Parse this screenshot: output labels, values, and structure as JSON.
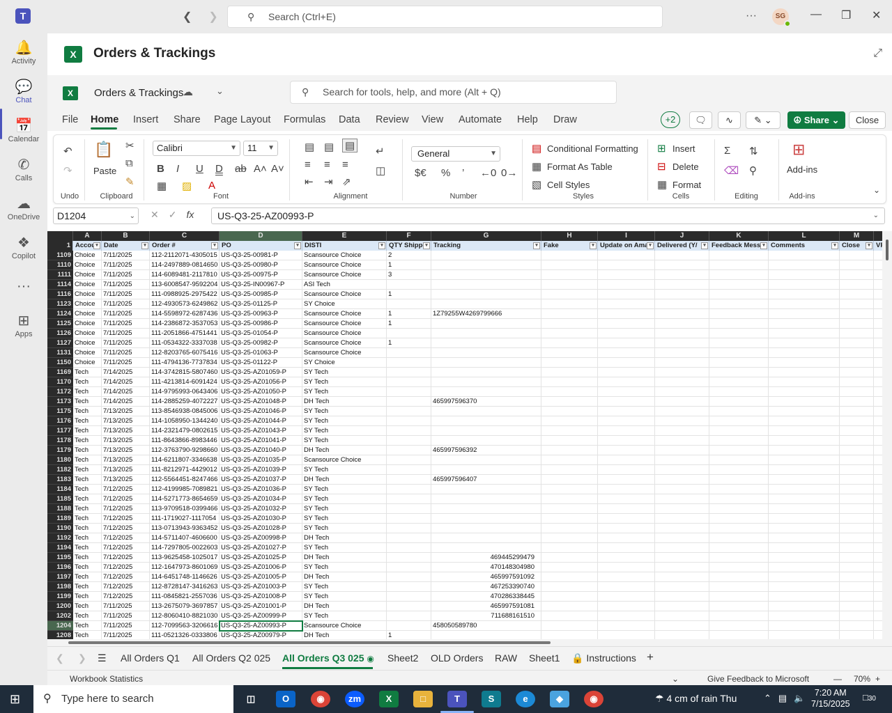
{
  "teams": {
    "search_placeholder": "Search (Ctrl+E)",
    "avatar_initials": "SG",
    "rail": [
      {
        "label": "Activity",
        "icon": "bell-icon"
      },
      {
        "label": "Chat",
        "icon": "chat-icon"
      },
      {
        "label": "Calendar",
        "icon": "calendar-icon"
      },
      {
        "label": "Calls",
        "icon": "phone-icon"
      },
      {
        "label": "OneDrive",
        "icon": "cloud-icon"
      },
      {
        "label": "Copilot",
        "icon": "copilot-icon"
      },
      {
        "label": "Apps",
        "icon": "apps-icon"
      }
    ]
  },
  "app": {
    "title": "Orders & Trackings",
    "doc_name": "Orders & Trackings",
    "tools_search": "Search for tools, help, and more (Alt + Q)",
    "menus": [
      "File",
      "Home",
      "Insert",
      "Share",
      "Page Layout",
      "Formulas",
      "Data",
      "Review",
      "View",
      "Automate",
      "Help",
      "Draw"
    ],
    "collaborators": "+2",
    "share_label": "Share",
    "close_label": "Close"
  },
  "ribbon": {
    "undo_label": "Undo",
    "clipboard_label": "Clipboard",
    "paste_label": "Paste",
    "font_label": "Font",
    "font_name": "Calibri",
    "font_size": "11",
    "alignment_label": "Alignment",
    "number_label": "Number",
    "number_format": "General",
    "styles_label": "Styles",
    "conditional_formatting": "Conditional Formatting",
    "format_as_table": "Format As Table",
    "cell_styles": "Cell Styles",
    "cells_label": "Cells",
    "insert": "Insert",
    "delete": "Delete",
    "format": "Format",
    "editing_label": "Editing",
    "addins_label": "Add-ins",
    "addins_btn": "Add-ins"
  },
  "formula_bar": {
    "name_box": "D1204",
    "formula": "US-Q3-25-AZ00993-P"
  },
  "sheet": {
    "columns": [
      "A",
      "B",
      "C",
      "D",
      "E",
      "F",
      "G",
      "H",
      "I",
      "J",
      "K",
      "L",
      "M"
    ],
    "headers": [
      "Accou",
      "Date",
      "Order #",
      "PO",
      "DISTI",
      "QTY Shippe",
      "Tracking",
      "Fake",
      "Update on Ama",
      "Delivered (Y/",
      "Feedback Messa",
      "Comments",
      "Close",
      "VP"
    ],
    "header_row_num": "1",
    "rows": [
      [
        "1109",
        "Choice",
        "7/11/2025",
        "112-2112071-4305015",
        "US-Q3-25-00981-P",
        "Scansource Choice",
        "2",
        "",
        ""
      ],
      [
        "1110",
        "Choice",
        "7/11/2025",
        "114-2497889-0814650",
        "US-Q3-25-00980-P",
        "Scansource Choice",
        "1",
        "",
        ""
      ],
      [
        "1111",
        "Choice",
        "7/11/2025",
        "114-6089481-2117810",
        "US-Q3-25-00975-P",
        "Scansource Choice",
        "3",
        "",
        ""
      ],
      [
        "1114",
        "Choice",
        "7/11/2025",
        "113-6008547-9592204",
        "US-Q3-25-IN00967-P",
        "ASI Tech",
        "",
        "",
        ""
      ],
      [
        "1116",
        "Choice",
        "7/11/2025",
        "111-0988925-2975422",
        "US-Q3-25-00985-P",
        "Scansource Choice",
        "1",
        "",
        ""
      ],
      [
        "1123",
        "Choice",
        "7/11/2025",
        "112-4930573-6249862",
        "US-Q3-25-01125-P",
        "SY Choice",
        "",
        "",
        ""
      ],
      [
        "1124",
        "Choice",
        "7/11/2025",
        "114-5598972-6287436",
        "US-Q3-25-00963-P",
        "Scansource Choice",
        "1",
        "1Z79255W4269799666",
        ""
      ],
      [
        "1125",
        "Choice",
        "7/11/2025",
        "114-2386872-3537053",
        "US-Q3-25-00986-P",
        "Scansource Choice",
        "1",
        "",
        ""
      ],
      [
        "1126",
        "Choice",
        "7/11/2025",
        "111-2051866-4751441",
        "US-Q3-25-01054-P",
        "Scansource Choice",
        "",
        "",
        ""
      ],
      [
        "1127",
        "Choice",
        "7/11/2025",
        "111-0534322-3337038",
        "US-Q3-25-00982-P",
        "Scansource Choice",
        "1",
        "",
        ""
      ],
      [
        "1131",
        "Choice",
        "7/11/2025",
        "112-8203765-6075416",
        "US-Q3-25-01063-P",
        "Scansource Choice",
        "",
        "",
        ""
      ],
      [
        "1150",
        "Choice",
        "7/11/2025",
        "111-4794136-7737834",
        "US-Q3-25-01122-P",
        "SY Choice",
        "",
        "",
        ""
      ],
      [
        "1169",
        "Tech",
        "7/14/2025",
        "114-3742815-5807460",
        "US-Q3-25-AZ01059-P",
        "SY Tech",
        "",
        "",
        ""
      ],
      [
        "1170",
        "Tech",
        "7/14/2025",
        "111-4213814-6091424",
        "US-Q3-25-AZ01056-P",
        "SY Tech",
        "",
        "",
        ""
      ],
      [
        "1172",
        "Tech",
        "7/14/2025",
        "114-9795993-0643406",
        "US-Q3-25-AZ01050-P",
        "SY Tech",
        "",
        "",
        ""
      ],
      [
        "1173",
        "Tech",
        "7/14/2025",
        "114-2885259-4072227",
        "US-Q3-25-AZ01048-P",
        "DH Tech",
        "",
        "465997596370",
        ""
      ],
      [
        "1175",
        "Tech",
        "7/13/2025",
        "113-8546938-0845006",
        "US-Q3-25-AZ01046-P",
        "SY Tech",
        "",
        "",
        ""
      ],
      [
        "1176",
        "Tech",
        "7/13/2025",
        "114-1058950-1344240",
        "US-Q3-25-AZ01044-P",
        "SY Tech",
        "",
        "",
        ""
      ],
      [
        "1177",
        "Tech",
        "7/13/2025",
        "114-2321479-0802615",
        "US-Q3-25-AZ01043-P",
        "SY Tech",
        "",
        "",
        ""
      ],
      [
        "1178",
        "Tech",
        "7/13/2025",
        "111-8643866-8983446",
        "US-Q3-25-AZ01041-P",
        "SY Tech",
        "",
        "",
        ""
      ],
      [
        "1179",
        "Tech",
        "7/13/2025",
        "112-3763790-9298660",
        "US-Q3-25-AZ01040-P",
        "DH Tech",
        "",
        "465997596392",
        ""
      ],
      [
        "1180",
        "Tech",
        "7/13/2025",
        "114-6211807-3346638",
        "US-Q3-25-AZ01035-P",
        "Scansource Choice",
        "",
        "",
        ""
      ],
      [
        "1182",
        "Tech",
        "7/13/2025",
        "111-8212971-4429012",
        "US-Q3-25-AZ01039-P",
        "SY Tech",
        "",
        "",
        ""
      ],
      [
        "1183",
        "Tech",
        "7/13/2025",
        "112-5564451-8247466",
        "US-Q3-25-AZ01037-P",
        "DH Tech",
        "",
        "465997596407",
        ""
      ],
      [
        "1184",
        "Tech",
        "7/12/2025",
        "112-4199985-7089821",
        "US-Q3-25-AZ01036-P",
        "SY Tech",
        "",
        "",
        ""
      ],
      [
        "1185",
        "Tech",
        "7/12/2025",
        "114-5271773-8654659",
        "US-Q3-25-AZ01034-P",
        "SY Tech",
        "",
        "",
        ""
      ],
      [
        "1188",
        "Tech",
        "7/12/2025",
        "113-9709518-0399466",
        "US-Q3-25-AZ01032-P",
        "SY Tech",
        "",
        "",
        ""
      ],
      [
        "1189",
        "Tech",
        "7/12/2025",
        "111-1719027-1117054",
        "US-Q3-25-AZ01030-P",
        "SY Tech",
        "",
        "",
        ""
      ],
      [
        "1190",
        "Tech",
        "7/12/2025",
        "113-0713943-9363452",
        "US-Q3-25-AZ01028-P",
        "SY Tech",
        "",
        "",
        ""
      ],
      [
        "1192",
        "Tech",
        "7/12/2025",
        "114-5711407-4606600",
        "US-Q3-25-AZ00998-P",
        "DH Tech",
        "",
        "",
        ""
      ],
      [
        "1194",
        "Tech",
        "7/12/2025",
        "114-7297805-0022603",
        "US-Q3-25-AZ01027-P",
        "SY Tech",
        "",
        "",
        ""
      ],
      [
        "1195",
        "Tech",
        "7/12/2025",
        "113-9625458-1025017",
        "US-Q3-25-AZ01025-P",
        "DH Tech",
        "",
        "",
        "469445299479"
      ],
      [
        "1196",
        "Tech",
        "7/12/2025",
        "112-1647973-8601069",
        "US-Q3-25-AZ01006-P",
        "SY Tech",
        "",
        "",
        "470148304980"
      ],
      [
        "1197",
        "Tech",
        "7/12/2025",
        "114-6451748-1146626",
        "US-Q3-25-AZ01005-P",
        "DH Tech",
        "",
        "",
        "465997591092"
      ],
      [
        "1198",
        "Tech",
        "7/12/2025",
        "112-8728147-3416263",
        "US-Q3-25-AZ01003-P",
        "SY Tech",
        "",
        "",
        "467253390740"
      ],
      [
        "1199",
        "Tech",
        "7/12/2025",
        "111-0845821-2557036",
        "US-Q3-25-AZ01008-P",
        "SY Tech",
        "",
        "",
        "470286338445"
      ],
      [
        "1200",
        "Tech",
        "7/11/2025",
        "113-2675079-3697857",
        "US-Q3-25-AZ01001-P",
        "DH Tech",
        "",
        "",
        "465997591081"
      ],
      [
        "1202",
        "Tech",
        "7/11/2025",
        "112-8060410-8821030",
        "US-Q3-25-AZ00999-P",
        "SY Tech",
        "",
        "",
        "711688161510"
      ],
      [
        "1204",
        "Tech",
        "7/11/2025",
        "112-7099563-3206616",
        "US-Q3-25-AZ00993-P",
        "Scansource Choice",
        "",
        "458050589780",
        ""
      ],
      [
        "1208",
        "Tech",
        "7/11/2025",
        "111-0521326-0333806",
        "US-Q3-25-AZ00979-P",
        "DH Tech",
        "1",
        "",
        ""
      ]
    ]
  },
  "tabs": [
    "All Orders Q1",
    "All Orders Q2 025",
    "All Orders Q3 025",
    "Sheet2",
    "OLD Orders",
    "RAW",
    "Sheet1",
    "Instructions"
  ],
  "status": {
    "workbook_stats": "Workbook Statistics",
    "feedback": "Give Feedback to Microsoft",
    "zoom": "70%"
  },
  "taskbar": {
    "search": "Type here to search",
    "weather": "4 cm of rain Thu",
    "time": "7:20 AM",
    "date": "7/15/2025",
    "notif_count": "30"
  }
}
